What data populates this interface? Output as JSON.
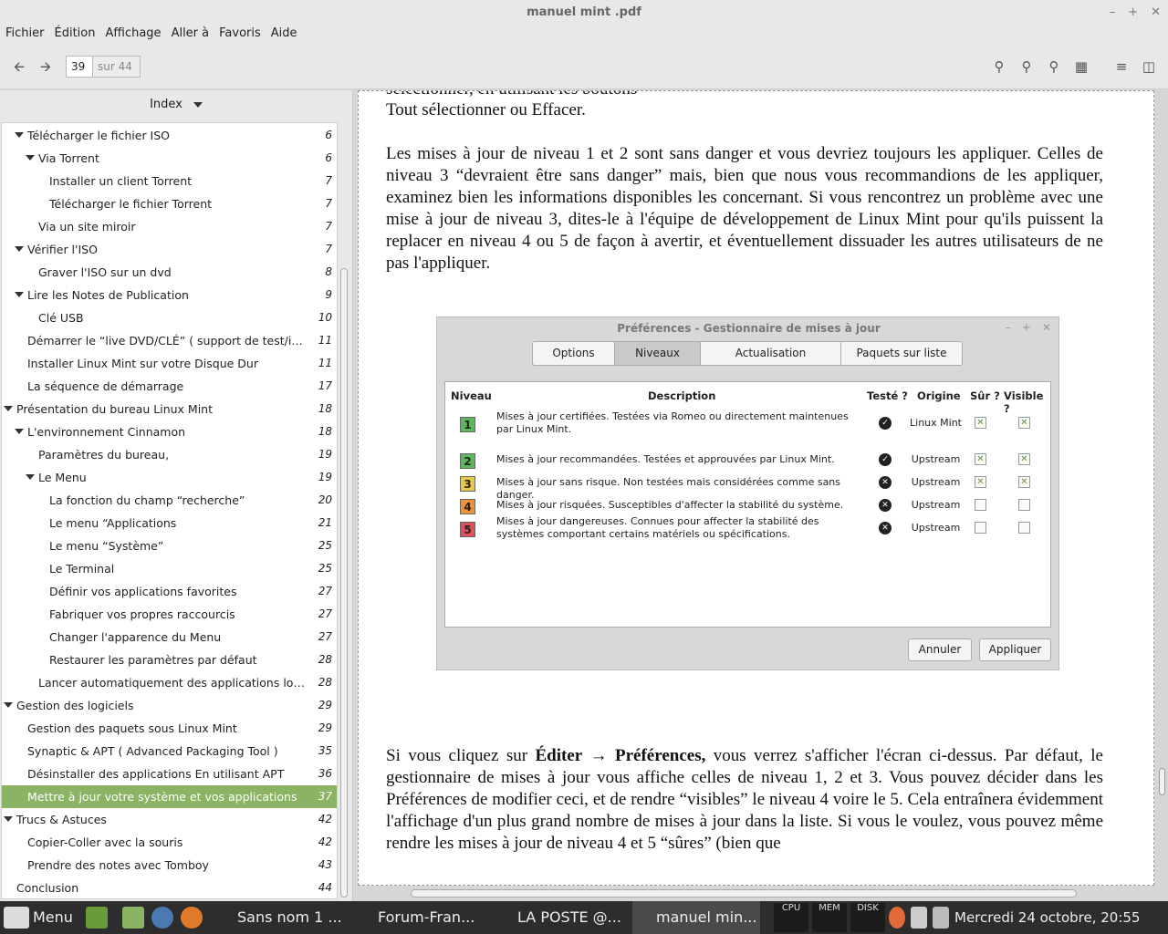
{
  "window": {
    "title": "manuel mint .pdf",
    "controls": [
      "–",
      "+",
      "✕"
    ]
  },
  "menubar": [
    "Fichier",
    "Édition",
    "Affichage",
    "Aller à",
    "Favoris",
    "Aide"
  ],
  "toolbar": {
    "page_current": "39",
    "page_total": "sur 44"
  },
  "sidebar": {
    "header": "Index",
    "items": [
      {
        "label": "Télécharger le fichier ISO",
        "page": "6",
        "expanded": true
      },
      {
        "label": "Via Torrent",
        "page": "6",
        "expanded": true
      },
      {
        "label": "Installer un client Torrent",
        "page": "7"
      },
      {
        "label": "Télécharger le fichier Torrent",
        "page": "7"
      },
      {
        "label": "Via un site miroir",
        "page": "7"
      },
      {
        "label": "Vérifier l'ISO",
        "page": "7",
        "expanded": true
      },
      {
        "label": "Graver l'ISO sur un dvd",
        "page": "8"
      },
      {
        "label": "Lire les Notes de Publication",
        "page": "9",
        "expanded": true
      },
      {
        "label": "Clé USB",
        "page": "10"
      },
      {
        "label": "Démarrer le “live DVD/CLÉ” ( support de test/insta...",
        "page": "11"
      },
      {
        "label": "Installer Linux Mint sur votre Disque Dur",
        "page": "11"
      },
      {
        "label": "La séquence de démarrage",
        "page": "17"
      },
      {
        "label": "Présentation du bureau Linux Mint",
        "page": "18",
        "expanded": true
      },
      {
        "label": "L'environnement Cinnamon",
        "page": "18",
        "expanded": true
      },
      {
        "label": "Paramètres du bureau,",
        "page": "19"
      },
      {
        "label": "Le Menu",
        "page": "19",
        "expanded": true
      },
      {
        "label": "La fonction du champ “recherche”",
        "page": "20"
      },
      {
        "label": "Le menu “Applications",
        "page": "21"
      },
      {
        "label": "Le menu “Système”",
        "page": "25"
      },
      {
        "label": "Le Terminal",
        "page": "25"
      },
      {
        "label": "Définir vos applications favorites",
        "page": "27"
      },
      {
        "label": "Fabriquer vos propres raccourcis",
        "page": "27"
      },
      {
        "label": "Changer l'apparence du Menu",
        "page": "27"
      },
      {
        "label": "Restaurer les paramètres par défaut",
        "page": "28"
      },
      {
        "label": "Lancer automatiquement des applications lorsque...",
        "page": "28"
      },
      {
        "label": "Gestion des logiciels",
        "page": "29",
        "expanded": true
      },
      {
        "label": "Gestion des paquets sous Linux Mint",
        "page": "29"
      },
      {
        "label": "Synaptic & APT ( Advanced Packaging Tool )",
        "page": "35"
      },
      {
        "label": "Désinstaller des applications En utilisant APT",
        "page": "36"
      },
      {
        "label": "Mettre à jour votre système et vos applications",
        "page": "37",
        "selected": true
      },
      {
        "label": "Trucs & Astuces",
        "page": "42",
        "expanded": true
      },
      {
        "label": "Copier-Coller avec la souris",
        "page": "42"
      },
      {
        "label": "Prendre des notes avec Tomboy",
        "page": "43"
      },
      {
        "label": "Conclusion",
        "page": "44"
      }
    ]
  },
  "document": {
    "clipped_line": "sélectionner, en utilisant les boutons",
    "line1": "Tout sélectionner  ou  Effacer.",
    "para1": "Les mises à jour de niveau 1 et 2 sont sans danger et vous devriez toujours les appliquer. Celles de niveau 3 “devraient être sans danger” mais, bien que nous vous recommandions de les appliquer, examinez bien les informations disponibles les concernant. Si vous rencontrez un problème avec une mise à jour de niveau 3, dites-le à l'équipe de développement de Linux Mint pour qu'ils puissent la replacer en niveau 4 ou 5 de façon à avertir, et éventuellement dissuader les autres utilisateurs de ne pas l'appliquer.",
    "para2_pre": "Si vous cliquez sur ",
    "para2_bold1": "Éditer",
    "para2_arrow": " → ",
    "para2_bold2": "Préférences,",
    "para2_post": " vous verrez s'afficher l'écran ci-dessus. Par défaut, le gestionnaire de mises à jour vous affiche celles de niveau 1, 2 et 3. Vous pouvez décider dans les Préférences de modifier ceci, et de rendre “visibles” le niveau 4 voire le 5. Cela entraînera évidemment l'affichage d'un plus grand nombre de mises à jour dans la liste. Si vous le voulez, vous pouvez même rendre les mises à jour de niveau 4 et 5 “sûres” (bien que"
  },
  "screenshot": {
    "title": "Préférences - Gestionnaire de mises à jour",
    "tabs": [
      "Options",
      "Niveaux",
      "Actualisation automatique",
      "Paquets sur liste noire"
    ],
    "headers": {
      "niveau": "Niveau",
      "description": "Description",
      "teste": "Testé ?",
      "origine": "Origine",
      "sur": "Sûr ?",
      "visible": "Visible ?"
    },
    "rows": [
      {
        "level": "1",
        "color": "#5cb85c",
        "desc": "Mises à jour certifiées. Testées via Romeo ou directement maintenues par Linux Mint.",
        "tested": "✓",
        "origin": "Linux Mint",
        "safe": true,
        "visible": true
      },
      {
        "level": "2",
        "color": "#5cb85c",
        "desc": "Mises à jour recommandées. Testées et approuvées par Linux Mint.",
        "tested": "✓",
        "origin": "Upstream",
        "safe": true,
        "visible": true
      },
      {
        "level": "3",
        "color": "#e6c84a",
        "desc": "Mises à jour sans risque. Non testées mais considérées comme sans danger.",
        "tested": "✕",
        "origin": "Upstream",
        "safe": true,
        "visible": true
      },
      {
        "level": "4",
        "color": "#f0913c",
        "desc": "Mises à jour risquées. Susceptibles d'affecter la stabilité du système.",
        "tested": "✕",
        "origin": "Upstream",
        "safe": false,
        "visible": false
      },
      {
        "level": "5",
        "color": "#e0505a",
        "desc": "Mises à jour dangereuses. Connues pour affecter la stabilité des systèmes comportant certains matériels ou spécifications.",
        "tested": "✕",
        "origin": "Upstream",
        "safe": false,
        "visible": false
      }
    ],
    "cancel": "Annuler",
    "apply": "Appliquer"
  },
  "taskbar": {
    "menu": "Menu",
    "windows": [
      "Sans nom 1 ...",
      "Forum-Fran...",
      "LA POSTE @....",
      "manuel min..."
    ],
    "monitors": [
      "CPU",
      "MEM",
      "DISK"
    ],
    "clock": "Mercredi 24 octobre, 20:55"
  },
  "colors": {
    "selection": "#8ab464",
    "taskbar": "#2d2d2d"
  }
}
